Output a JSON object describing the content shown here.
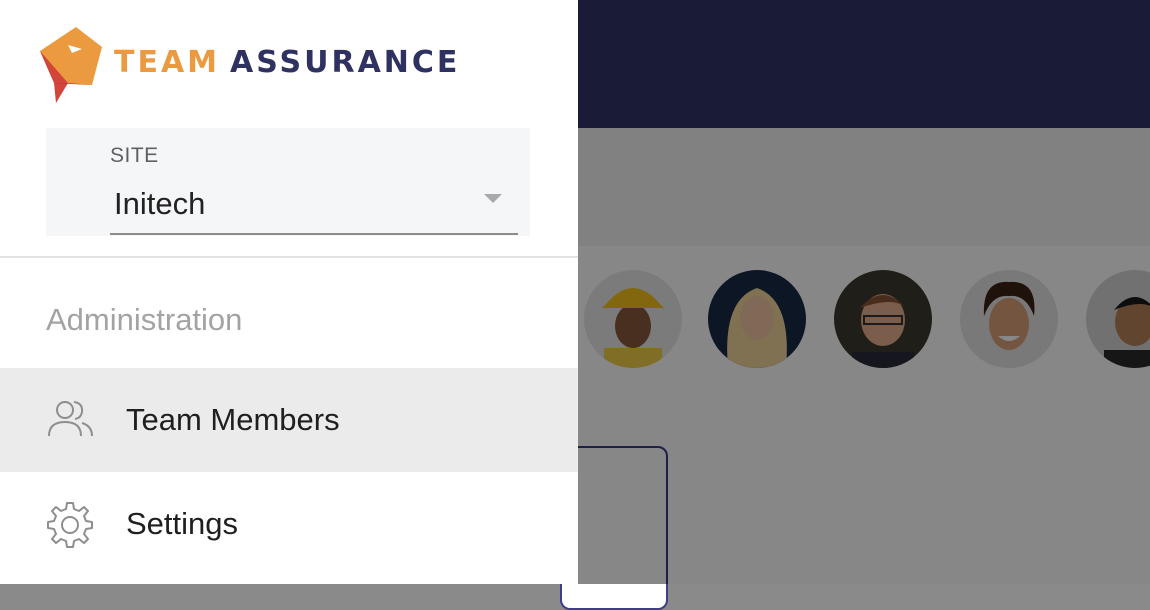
{
  "brand": {
    "name_part1": "TEAM",
    "name_part2": "ASSURANCE",
    "logo_icon": "team-assurance-logo",
    "colors": {
      "orange": "#ec9a3f",
      "navy": "#2f3160",
      "red": "#d2453a"
    }
  },
  "site_select": {
    "label": "SITE",
    "value": "Initech",
    "dropdown_icon": "caret-down-icon"
  },
  "navigation": {
    "section_heading": "Administration",
    "items": [
      {
        "label": "Team Members",
        "icon": "users-icon",
        "active": true
      },
      {
        "label": "Settings",
        "icon": "gear-icon",
        "active": false
      }
    ]
  },
  "background": {
    "header_color": "#323466",
    "avatars": [
      "avatar-construction-worker",
      "avatar-blonde-woman",
      "avatar-man-glasses",
      "avatar-curly-hair-man",
      "avatar-smiling-man"
    ]
  }
}
